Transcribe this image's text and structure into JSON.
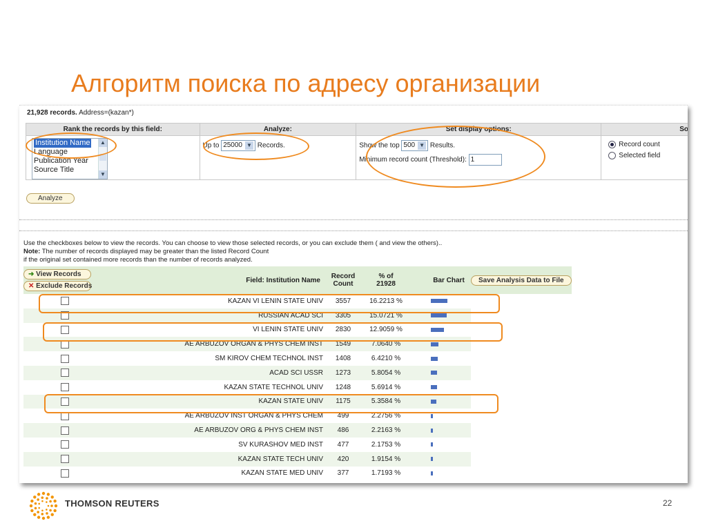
{
  "slide_title": "Алгоритм поиска по адресу организации",
  "summary": {
    "count": "21,928 records.",
    "query": "Address=(kazan*)"
  },
  "options": {
    "rank_header": "Rank the records by this field:",
    "analyze_header": "Analyze:",
    "display_header": "Set display options:",
    "sort_header": "Sort by:",
    "rank_fields": [
      "Institution Name",
      "Language",
      "Publication Year",
      "Source Title"
    ],
    "up_to_label": "Up to",
    "up_to_value": "25000",
    "records_label": "Records.",
    "show_top_label": "Show the top",
    "show_top_value": "500",
    "results_label": "Results.",
    "min_count_label": "Minimum record count (Threshold):",
    "min_count_value": "1",
    "sort_options": [
      {
        "label": "Record count",
        "checked": true
      },
      {
        "label": "Selected field",
        "checked": false
      }
    ],
    "analyze_button": "Analyze"
  },
  "instructions": {
    "line1": "Use the checkboxes below to view the records. You can choose to view those selected records, or you can exclude them ( and view the others)..",
    "note_label": "Note:",
    "line2": " The number of records displayed may be greater than the listed Record Count",
    "line3": "if the original set contained more records than the number of records analyzed."
  },
  "results": {
    "view_button": "View Records",
    "exclude_button": "Exclude Records",
    "field_header": "Field: Institution Name",
    "count_header_1": "Record",
    "count_header_2": "Count",
    "pct_header_1": "% of",
    "pct_header_2": "21928",
    "bar_header": "Bar Chart",
    "save_button": "Save Analysis Data to File",
    "rows": [
      {
        "name": "KAZAN VI LENIN STATE UNIV",
        "count": "3557",
        "pct": "16.2213 %",
        "share": 16.2213
      },
      {
        "name": "RUSSIAN ACAD SCI",
        "count": "3305",
        "pct": "15.0721 %",
        "share": 15.0721
      },
      {
        "name": "VI LENIN STATE UNIV",
        "count": "2830",
        "pct": "12.9059 %",
        "share": 12.9059
      },
      {
        "name": "AE ARBUZOV ORGAN & PHYS CHEM INST",
        "count": "1549",
        "pct": "7.0640 %",
        "share": 7.064
      },
      {
        "name": "SM KIROV CHEM TECHNOL INST",
        "count": "1408",
        "pct": "6.4210 %",
        "share": 6.421
      },
      {
        "name": "ACAD SCI USSR",
        "count": "1273",
        "pct": "5.8054 %",
        "share": 5.8054
      },
      {
        "name": "KAZAN STATE TECHNOL UNIV",
        "count": "1248",
        "pct": "5.6914 %",
        "share": 5.6914
      },
      {
        "name": "KAZAN STATE UNIV",
        "count": "1175",
        "pct": "5.3584 %",
        "share": 5.3584
      },
      {
        "name": "AE ARBUZOV INST ORGAN & PHYS CHEM",
        "count": "499",
        "pct": "2.2756 %",
        "share": 2.2756
      },
      {
        "name": "AE ARBUZOV ORG & PHYS CHEM INST",
        "count": "486",
        "pct": "2.2163 %",
        "share": 2.2163
      },
      {
        "name": "SV KURASHOV MED INST",
        "count": "477",
        "pct": "2.1753 %",
        "share": 2.1753
      },
      {
        "name": "KAZAN STATE TECH UNIV",
        "count": "420",
        "pct": "1.9154 %",
        "share": 1.9154
      },
      {
        "name": "KAZAN STATE MED UNIV",
        "count": "377",
        "pct": "1.7193 %",
        "share": 1.7193
      }
    ]
  },
  "footer": {
    "brand": "THOMSON REUTERS",
    "page_number": "22"
  },
  "colors": {
    "accent": "#e87c1e",
    "bar": "#4a6fbd",
    "header_bg": "#e0eed8"
  }
}
